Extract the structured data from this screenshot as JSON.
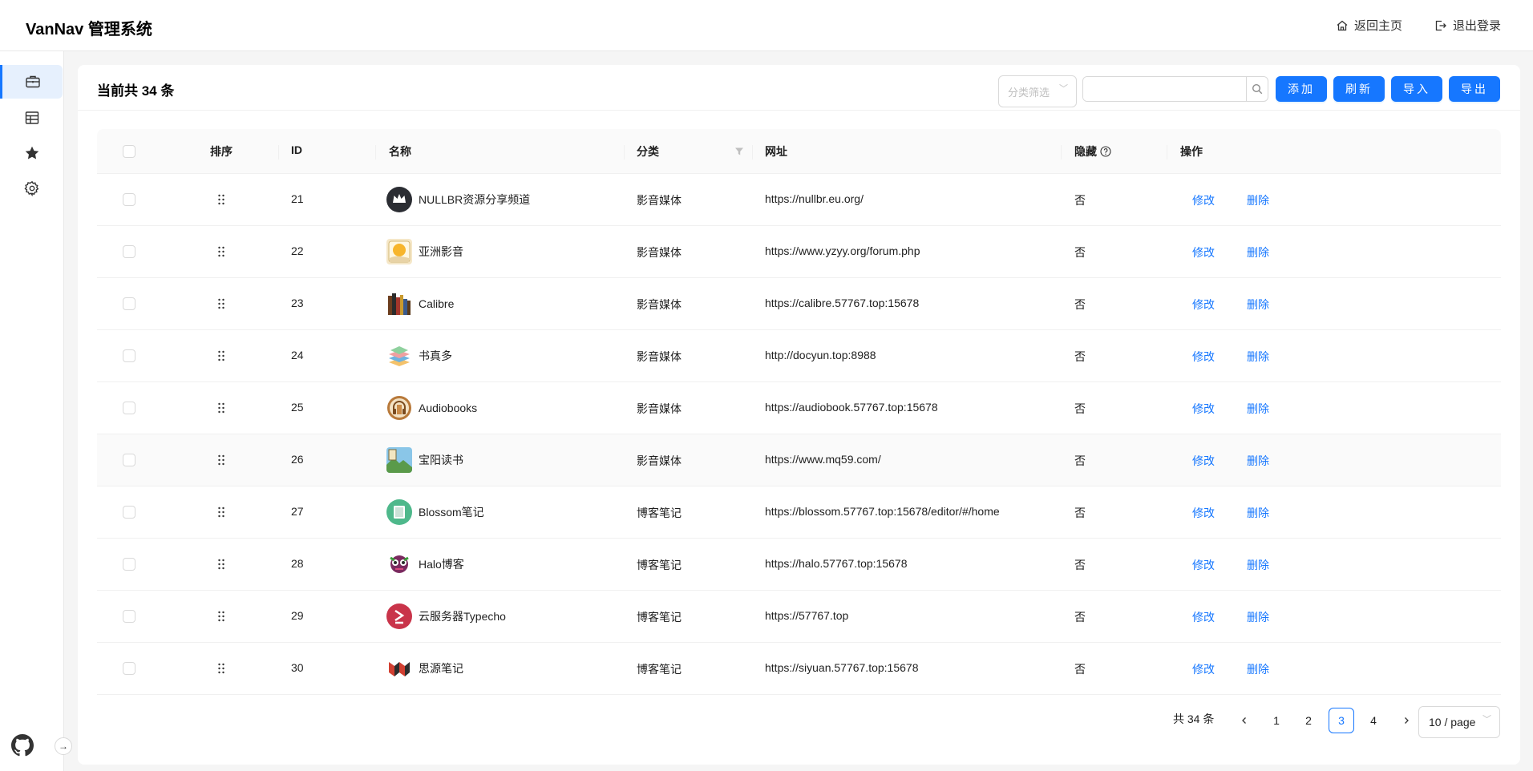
{
  "app": {
    "title": "VanNav 管理系统"
  },
  "topbar": {
    "home_label": "返回主页",
    "logout_label": "退出登录"
  },
  "sidebar": {
    "items": [
      {
        "icon": "briefcase-icon",
        "active": true
      },
      {
        "icon": "table-icon",
        "active": false
      },
      {
        "icon": "star-icon",
        "active": false
      },
      {
        "icon": "gear-icon",
        "active": false
      }
    ],
    "footer": {
      "github_icon": "github-icon",
      "collapse_label": "→"
    }
  },
  "header": {
    "count_text": "当前共 34 条",
    "filter_placeholder": "分类筛选",
    "search_value": "",
    "buttons": {
      "add": "添加",
      "refresh": "刷新",
      "import": "导入",
      "export": "导出"
    }
  },
  "table": {
    "columns": {
      "sort": "排序",
      "id": "ID",
      "name": "名称",
      "category": "分类",
      "url": "网址",
      "hidden": "隐藏",
      "actions": "操作"
    },
    "rows": [
      {
        "id": "21",
        "name": "NULLBR资源分享频道",
        "category": "影音媒体",
        "url": "https://nullbr.eu.org/",
        "hidden": "否",
        "edit": "修改",
        "delete": "删除",
        "icon": "crown-icon"
      },
      {
        "id": "22",
        "name": "亚洲影音",
        "category": "影音媒体",
        "url": "https://www.yzyy.org/forum.php",
        "hidden": "否",
        "edit": "修改",
        "delete": "删除",
        "icon": "sun-icon"
      },
      {
        "id": "23",
        "name": "Calibre",
        "category": "影音媒体",
        "url": "https://calibre.57767.top:15678",
        "hidden": "否",
        "edit": "修改",
        "delete": "删除",
        "icon": "books-icon"
      },
      {
        "id": "24",
        "name": "书真多",
        "category": "影音媒体",
        "url": "http://docyun.top:8988",
        "hidden": "否",
        "edit": "修改",
        "delete": "删除",
        "icon": "book-stack-icon"
      },
      {
        "id": "25",
        "name": "Audiobooks",
        "category": "影音媒体",
        "url": "https://audiobook.57767.top:15678",
        "hidden": "否",
        "edit": "修改",
        "delete": "删除",
        "icon": "audiobook-icon"
      },
      {
        "id": "26",
        "name": "宝阳读书",
        "category": "影音媒体",
        "url": "https://www.mq59.com/",
        "hidden": "否",
        "edit": "修改",
        "delete": "删除",
        "icon": "landscape-icon"
      },
      {
        "id": "27",
        "name": "Blossom笔记",
        "category": "博客笔记",
        "url": "https://blossom.57767.top:15678/editor/#/home",
        "hidden": "否",
        "edit": "修改",
        "delete": "删除",
        "icon": "blossom-icon"
      },
      {
        "id": "28",
        "name": "Halo博客",
        "category": "博客笔记",
        "url": "https://halo.57767.top:15678",
        "hidden": "否",
        "edit": "修改",
        "delete": "删除",
        "icon": "halo-icon"
      },
      {
        "id": "29",
        "name": "云服务器Typecho",
        "category": "博客笔记",
        "url": "https://57767.top",
        "hidden": "否",
        "edit": "修改",
        "delete": "删除",
        "icon": "typecho-icon"
      },
      {
        "id": "30",
        "name": "思源笔记",
        "category": "博客笔记",
        "url": "https://siyuan.57767.top:15678",
        "hidden": "否",
        "edit": "修改",
        "delete": "删除",
        "icon": "siyuan-icon"
      }
    ]
  },
  "pagination": {
    "total_text": "共 34 条",
    "pages": [
      "1",
      "2",
      "3",
      "4"
    ],
    "current": "3",
    "page_size": "10 / page"
  },
  "colors": {
    "primary": "#1677ff",
    "border": "#f0f0f0",
    "header_bg": "#fafafa"
  }
}
